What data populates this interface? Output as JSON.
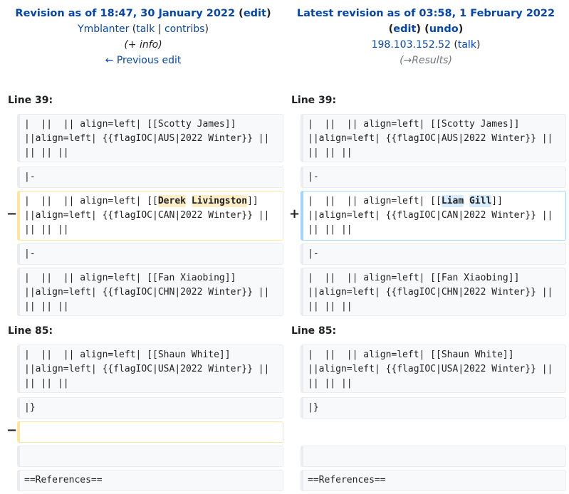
{
  "left": {
    "title_prefix": "Revision as of 18:47, 30 January 2022",
    "edit": "edit",
    "user": "Ymblanter",
    "talk": "talk",
    "contribs": "contribs",
    "info": "(+ info)",
    "prev": "← Previous edit"
  },
  "right": {
    "title_prefix": "Latest revision as of 03:58, 1 February 2022",
    "edit": "edit",
    "undo": "undo",
    "user": "198.103.152.52",
    "talk": "talk",
    "summary": "(→Results)"
  },
  "sections": [
    {
      "left_line": "Line 39:",
      "right_line": "Line 39:",
      "row1": "|  ||  || align=left| [[Scotty James]] ||align=left| {{flagIOC|AUS|2022 Winter}} || || || ||",
      "row2": "|-",
      "del_pre": "|  ||  || align=left| [[",
      "del_w1": "Derek",
      "del_w2": "Livingston",
      "del_post": "]] ||align=left| {{flagIOC|CAN|2022 Winter}} || || || ||",
      "add_pre": "|  ||  || align=left| [[",
      "add_w1": "Liam",
      "add_w2": "Gill",
      "add_post": "]] ||align=left| {{flagIOC|CAN|2022 Winter}} || || || ||",
      "row4": "|-",
      "row5": "|  ||  || align=left| [[Fan Xiaobing]] ||align=left| {{flagIOC|CHN|2022 Winter}} || || || ||"
    },
    {
      "left_line": "Line 85:",
      "right_line": "Line 85:",
      "row1": "|  ||  || align=left| [[Shaun White]] ||align=left| {{flagIOC|USA|2022 Winter}} || || || ||",
      "row2": "|}",
      "row4": "==References=="
    }
  ],
  "markers": {
    "minus": "−",
    "plus": "+"
  }
}
